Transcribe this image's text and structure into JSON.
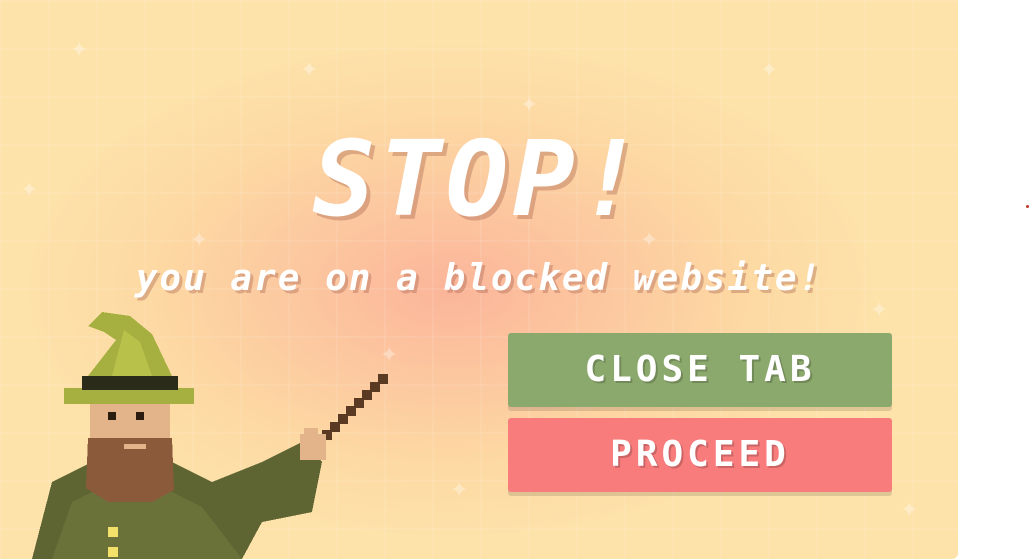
{
  "headline": "STOP!",
  "message": "you are on a blocked website!",
  "buttons": {
    "close_label": "CLOSE TAB",
    "proceed_label": "PROCEED"
  },
  "colors": {
    "background_center": "#fbb59a",
    "background_edge": "#fde2aa",
    "close_button": "#8ba86d",
    "proceed_button": "#f87c7c",
    "text": "#ffffff"
  },
  "illustration": "pixel-wizard-with-wand"
}
